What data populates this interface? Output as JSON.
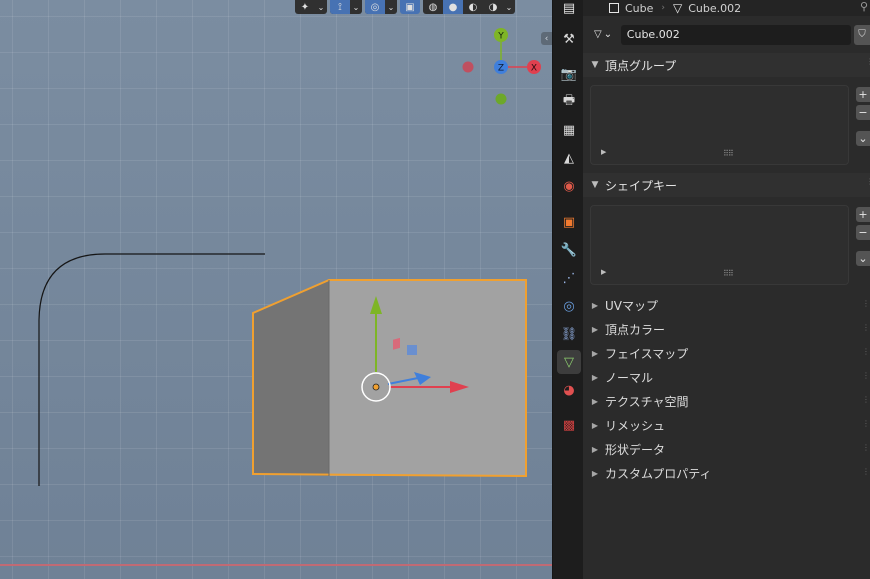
{
  "breadcrumb": {
    "object_name": "Cube",
    "mesh_name": "Cube.002"
  },
  "mesh_datablock": {
    "name": "Cube.002"
  },
  "panels": {
    "vertex_groups": {
      "label": "頂点グループ",
      "expanded": true
    },
    "shape_keys": {
      "label": "シェイプキー",
      "expanded": true
    }
  },
  "collapsed_panels": [
    {
      "label": "UVマップ"
    },
    {
      "label": "頂点カラー"
    },
    {
      "label": "フェイスマップ"
    },
    {
      "label": "ノーマル"
    },
    {
      "label": "テクスチャ空間"
    },
    {
      "label": "リメッシュ"
    },
    {
      "label": "形状データ"
    },
    {
      "label": "カスタムプロパティ"
    }
  ],
  "gizmo": {
    "x_label": "X",
    "y_label": "Y",
    "z_label": "Z"
  },
  "property_tabs": [
    {
      "icon": "tool-icon",
      "active": false
    },
    {
      "icon": "render-icon",
      "active": false
    },
    {
      "icon": "output-icon",
      "active": false
    },
    {
      "icon": "view-layer-icon",
      "active": false
    },
    {
      "icon": "scene-icon",
      "active": false
    },
    {
      "icon": "world-icon",
      "active": false
    },
    {
      "icon": "object-icon",
      "active": false
    },
    {
      "icon": "modifier-icon",
      "active": false
    },
    {
      "icon": "particles-icon",
      "active": false
    },
    {
      "icon": "physics-icon",
      "active": false
    },
    {
      "icon": "constraints-icon",
      "active": false
    },
    {
      "icon": "mesh-data-icon",
      "active": true
    },
    {
      "icon": "material-icon",
      "active": false
    },
    {
      "icon": "texture-icon",
      "active": false
    }
  ],
  "colors": {
    "accent": "#4772b3",
    "selection_outline": "#f0a030",
    "x_axis": "#e0404f",
    "y_axis": "#7eb526",
    "z_axis": "#3f7fdc",
    "viewport_bg": "#7b8da1",
    "panel_bg": "#2b2b2b"
  }
}
